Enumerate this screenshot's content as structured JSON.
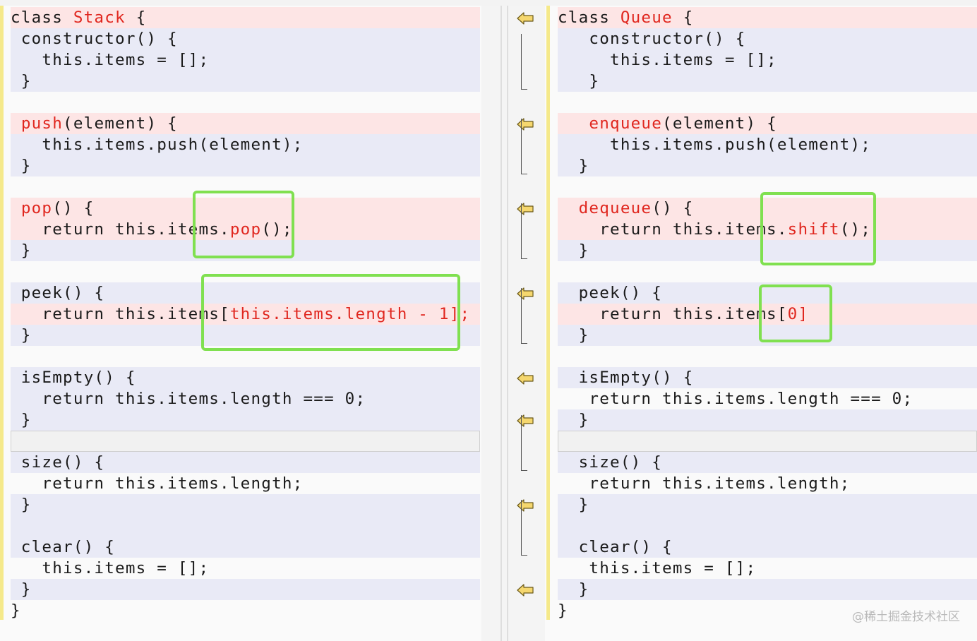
{
  "left": {
    "lines": [
      {
        "segments": [
          {
            "t": "class "
          },
          {
            "t": "Stack",
            "hl": true
          },
          {
            "t": " {"
          }
        ],
        "bg": "diff"
      },
      {
        "segments": [
          {
            "t": " constructor() {"
          }
        ],
        "bg": "mod"
      },
      {
        "segments": [
          {
            "t": "   this.items = [];"
          }
        ],
        "bg": "mod"
      },
      {
        "segments": [
          {
            "t": " }"
          }
        ],
        "bg": "mod"
      },
      {
        "segments": [
          {
            "t": ""
          }
        ],
        "bg": "norm"
      },
      {
        "segments": [
          {
            "t": " "
          },
          {
            "t": "push",
            "hl": true
          },
          {
            "t": "(element) {"
          }
        ],
        "bg": "diff"
      },
      {
        "segments": [
          {
            "t": "   this.items.push(element);"
          }
        ],
        "bg": "mod"
      },
      {
        "segments": [
          {
            "t": " }"
          }
        ],
        "bg": "mod"
      },
      {
        "segments": [
          {
            "t": ""
          }
        ],
        "bg": "norm"
      },
      {
        "segments": [
          {
            "t": " "
          },
          {
            "t": "pop",
            "hl": true
          },
          {
            "t": "() {"
          }
        ],
        "bg": "diff"
      },
      {
        "segments": [
          {
            "t": "   return this.items."
          },
          {
            "t": "pop",
            "hl": true
          },
          {
            "t": "();"
          }
        ],
        "bg": "diff"
      },
      {
        "segments": [
          {
            "t": " }"
          }
        ],
        "bg": "mod"
      },
      {
        "segments": [
          {
            "t": ""
          }
        ],
        "bg": "norm"
      },
      {
        "segments": [
          {
            "t": " peek() {"
          }
        ],
        "bg": "mod"
      },
      {
        "segments": [
          {
            "t": "   return this.items["
          },
          {
            "t": "this.items.length - 1];",
            "hl": true
          }
        ],
        "bg": "diff"
      },
      {
        "segments": [
          {
            "t": " }"
          }
        ],
        "bg": "mod"
      },
      {
        "segments": [
          {
            "t": ""
          }
        ],
        "bg": "norm"
      },
      {
        "segments": [
          {
            "t": " isEmpty() {"
          }
        ],
        "bg": "mod"
      },
      {
        "segments": [
          {
            "t": "   return this.items.length === 0;"
          }
        ],
        "bg": "mod"
      },
      {
        "segments": [
          {
            "t": " }"
          }
        ],
        "bg": "mod"
      },
      {
        "segments": [
          {
            "t": ""
          }
        ],
        "bg": "empty"
      },
      {
        "segments": [
          {
            "t": " size() {"
          }
        ],
        "bg": "mod"
      },
      {
        "segments": [
          {
            "t": "   return this.items.length;"
          }
        ],
        "bg": "norm"
      },
      {
        "segments": [
          {
            "t": " }"
          }
        ],
        "bg": "mod"
      },
      {
        "segments": [
          {
            "t": ""
          }
        ],
        "bg": "mod"
      },
      {
        "segments": [
          {
            "t": " clear() {"
          }
        ],
        "bg": "mod"
      },
      {
        "segments": [
          {
            "t": "   this.items = [];"
          }
        ],
        "bg": "norm"
      },
      {
        "segments": [
          {
            "t": " }"
          }
        ],
        "bg": "mod"
      },
      {
        "segments": [
          {
            "t": "}"
          }
        ],
        "bg": "norm"
      }
    ]
  },
  "right": {
    "lines": [
      {
        "segments": [
          {
            "t": "class "
          },
          {
            "t": "Queue",
            "hl": true
          },
          {
            "t": " {"
          }
        ],
        "bg": "diff"
      },
      {
        "segments": [
          {
            "t": "   constructor() {"
          }
        ],
        "bg": "mod"
      },
      {
        "segments": [
          {
            "t": "     this.items = [];"
          }
        ],
        "bg": "mod"
      },
      {
        "segments": [
          {
            "t": "   }"
          }
        ],
        "bg": "mod"
      },
      {
        "segments": [
          {
            "t": ""
          }
        ],
        "bg": "norm"
      },
      {
        "segments": [
          {
            "t": "   "
          },
          {
            "t": "enqueue",
            "hl": true
          },
          {
            "t": "(element) {"
          }
        ],
        "bg": "diff"
      },
      {
        "segments": [
          {
            "t": "     this.items.push(element);"
          }
        ],
        "bg": "mod"
      },
      {
        "segments": [
          {
            "t": "  }"
          }
        ],
        "bg": "mod"
      },
      {
        "segments": [
          {
            "t": ""
          }
        ],
        "bg": "norm"
      },
      {
        "segments": [
          {
            "t": "  "
          },
          {
            "t": "dequeue",
            "hl": true
          },
          {
            "t": "() {"
          }
        ],
        "bg": "diff"
      },
      {
        "segments": [
          {
            "t": "    return this.items."
          },
          {
            "t": "shift",
            "hl": true
          },
          {
            "t": "();"
          }
        ],
        "bg": "diff"
      },
      {
        "segments": [
          {
            "t": "  }"
          }
        ],
        "bg": "mod"
      },
      {
        "segments": [
          {
            "t": ""
          }
        ],
        "bg": "norm"
      },
      {
        "segments": [
          {
            "t": "  peek() {"
          }
        ],
        "bg": "mod"
      },
      {
        "segments": [
          {
            "t": "    return this.items["
          },
          {
            "t": "0]",
            "hl": true
          }
        ],
        "bg": "diff"
      },
      {
        "segments": [
          {
            "t": "  }"
          }
        ],
        "bg": "mod"
      },
      {
        "segments": [
          {
            "t": ""
          }
        ],
        "bg": "norm"
      },
      {
        "segments": [
          {
            "t": "  isEmpty() {"
          }
        ],
        "bg": "mod"
      },
      {
        "segments": [
          {
            "t": "   return this.items.length === 0;"
          }
        ],
        "bg": "norm"
      },
      {
        "segments": [
          {
            "t": "  }"
          }
        ],
        "bg": "mod"
      },
      {
        "segments": [
          {
            "t": ""
          }
        ],
        "bg": "empty"
      },
      {
        "segments": [
          {
            "t": "  size() {"
          }
        ],
        "bg": "mod"
      },
      {
        "segments": [
          {
            "t": "   return this.items.length;"
          }
        ],
        "bg": "norm"
      },
      {
        "segments": [
          {
            "t": "  }"
          }
        ],
        "bg": "mod"
      },
      {
        "segments": [
          {
            "t": ""
          }
        ],
        "bg": "mod"
      },
      {
        "segments": [
          {
            "t": "  clear() {"
          }
        ],
        "bg": "mod"
      },
      {
        "segments": [
          {
            "t": "   this.items = [];"
          }
        ],
        "bg": "norm"
      },
      {
        "segments": [
          {
            "t": "  }"
          }
        ],
        "bg": "mod"
      },
      {
        "segments": [
          {
            "t": "}"
          }
        ],
        "bg": "norm"
      }
    ]
  },
  "gutter": {
    "icon": "copy-left-arrow-icon",
    "arrow_color": "#f5d76e"
  },
  "watermark": "@稀土掘金技术社区",
  "colors": {
    "highlight": "#e0271f",
    "diff_bg": "#fde5e5",
    "modified_bg": "#e9eaf6",
    "box": "#80e050"
  }
}
